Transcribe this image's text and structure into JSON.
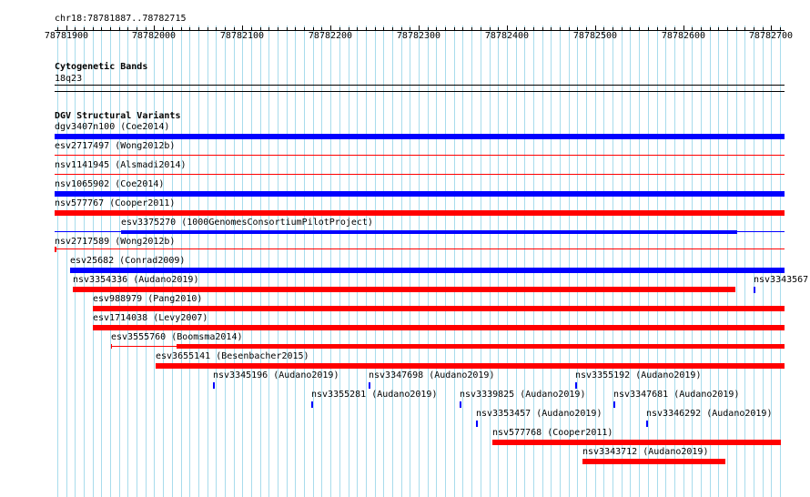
{
  "ruler": {
    "location": "chr18:78781887..78782715",
    "ticks": [
      "78781900",
      "78782000",
      "78782100",
      "78782200",
      "78782300",
      "78782400",
      "78782500",
      "78782600",
      "78782700"
    ],
    "start": 78781887,
    "end": 78782715
  },
  "cytoband_track": {
    "title": "Cytogenetic Bands",
    "band": "18q23"
  },
  "dgv_track": {
    "title": "DGV Structural Variants",
    "colors": {
      "loss": "#ff0000",
      "gain": "#0000ff",
      "separator": "#ff0000"
    },
    "features": [
      {
        "label": "dgv3407n100 (Coe2014)",
        "start": 78781887,
        "end": 78782715,
        "color": "gain"
      },
      {
        "label": "esv2717497 (Wong2012b)",
        "start": 78781887,
        "end": 78782715,
        "color": "loss_thin"
      },
      {
        "label": "nsv1141945 (Alsmadi2014)",
        "start": 78781887,
        "end": 78782715,
        "color": "loss_thin"
      },
      {
        "label": "nsv1065902 (Coe2014)",
        "start": 78781887,
        "end": 78782715,
        "color": "gain"
      },
      {
        "label": "nsv577767 (Cooper2011)",
        "start": 78781887,
        "end": 78782715,
        "color": "loss"
      },
      {
        "label": "esv3375270 (1000GenomesConsortiumPilotProject)",
        "start": 78781962,
        "end": 78782661,
        "color": "gain_mid"
      },
      {
        "label": "nsv2717589 (Wong2012b)",
        "start": 78781887,
        "end": 78781889,
        "color": "loss_thin"
      },
      {
        "label": "esv25682 (Conrad2009)",
        "start": 78781905,
        "end": 78782715,
        "color": "gain"
      },
      {
        "label": "nsv3354336 (Audano2019)",
        "start": 78781908,
        "end": 78782660,
        "color": "loss"
      },
      {
        "label": "nsv3343567",
        "start": 78782680,
        "end": 78782682,
        "color": "gain_dot"
      },
      {
        "label": "esv988979 (Pang2010)",
        "start": 78781930,
        "end": 78782715,
        "color": "loss"
      },
      {
        "label": "esv1714038 (Levy2007)",
        "start": 78781930,
        "end": 78782715,
        "color": "loss"
      },
      {
        "label": "esv3555760 (Boomsma2014)",
        "start": 78781951,
        "end": 78782715,
        "color": "loss_split"
      },
      {
        "label": "esv3655141 (Besenbacher2015)",
        "start": 78782002,
        "end": 78782715,
        "color": "loss"
      },
      {
        "label": "nsv3345196 (Audano2019)",
        "start": 78782067,
        "end": 78782069,
        "color": "gain_dot"
      },
      {
        "label": "nsv3347698 (Audano2019)",
        "start": 78782243,
        "end": 78782245,
        "color": "gain_dot"
      },
      {
        "label": "nsv3355192 (Audano2019)",
        "start": 78782478,
        "end": 78782480,
        "color": "gain_dot"
      },
      {
        "label": "nsv3355281 (Audano2019)",
        "start": 78782178,
        "end": 78782180,
        "color": "gain_dot"
      },
      {
        "label": "nsv3339825 (Audano2019)",
        "start": 78782346,
        "end": 78782348,
        "color": "gain_dot"
      },
      {
        "label": "nsv3347681 (Audano2019)",
        "start": 78782521,
        "end": 78782523,
        "color": "gain_dot"
      },
      {
        "label": "nsv3353457 (Audano2019)",
        "start": 78782365,
        "end": 78782367,
        "color": "gain_dot"
      },
      {
        "label": "nsv3346292 (Audano2019)",
        "start": 78782558,
        "end": 78782560,
        "color": "gain_dot"
      },
      {
        "label": "nsv577768 (Cooper2011)",
        "start": 78782384,
        "end": 78782711,
        "color": "loss"
      },
      {
        "label": "nsv3343712 (Audano2019)",
        "start": 78782486,
        "end": 78782648,
        "color": "loss"
      }
    ]
  }
}
